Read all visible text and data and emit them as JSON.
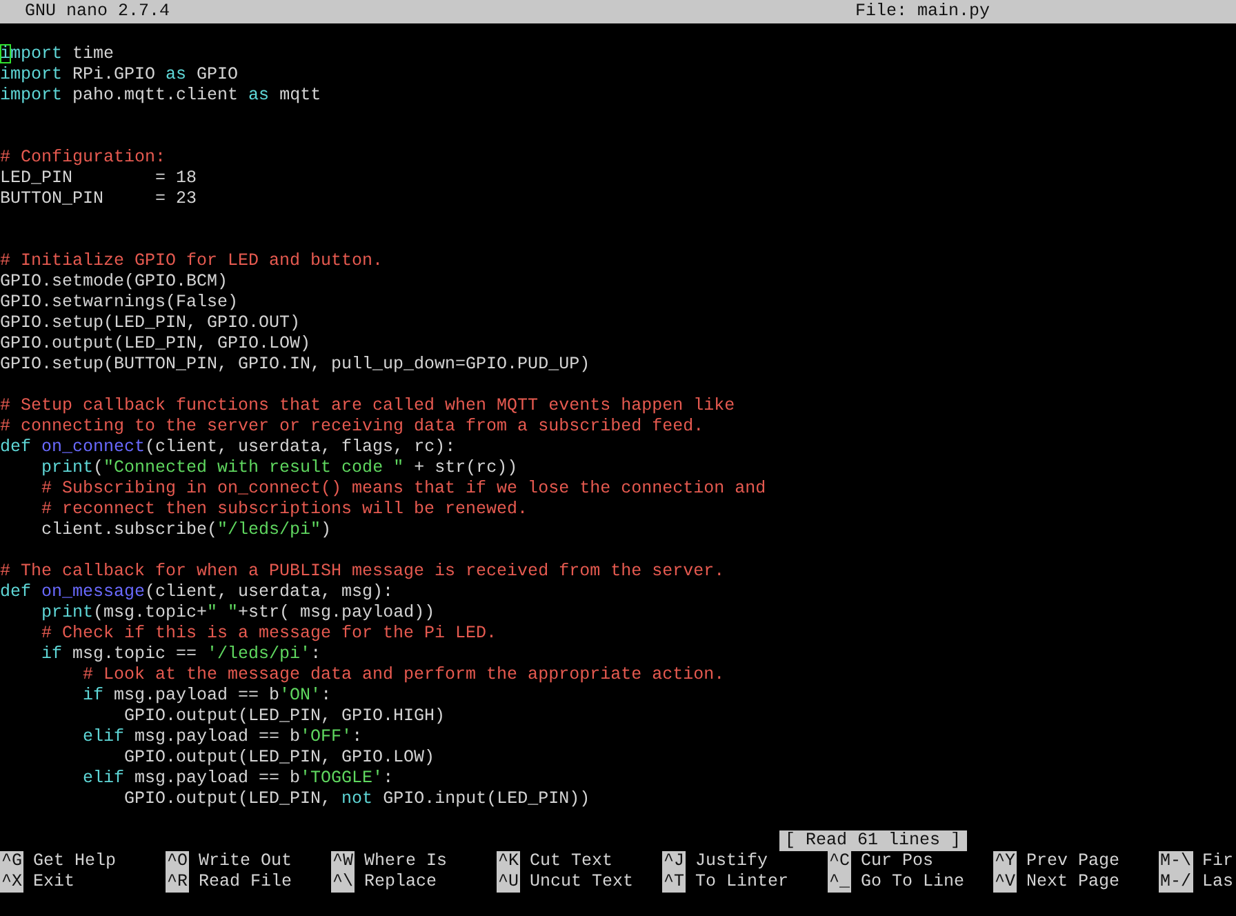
{
  "title_bar": {
    "app": "GNU nano 2.7.4",
    "file": "File: main.py"
  },
  "lines": [
    {
      "kind": "code",
      "segments": [
        {
          "text": "i",
          "kind": "keyword",
          "cursor": true
        },
        {
          "text": "mport",
          "kind": "keyword"
        },
        {
          "text": " time",
          "kind": "plain"
        }
      ]
    },
    {
      "kind": "code",
      "segments": [
        {
          "text": "import",
          "kind": "keyword"
        },
        {
          "text": " RPi.GPIO ",
          "kind": "plain"
        },
        {
          "text": "as",
          "kind": "keyword"
        },
        {
          "text": " GPIO",
          "kind": "plain"
        }
      ]
    },
    {
      "kind": "code",
      "segments": [
        {
          "text": "import",
          "kind": "keyword"
        },
        {
          "text": " paho.mqtt.client ",
          "kind": "plain"
        },
        {
          "text": "as",
          "kind": "keyword"
        },
        {
          "text": " mqtt",
          "kind": "plain"
        }
      ]
    },
    {
      "kind": "blank"
    },
    {
      "kind": "blank"
    },
    {
      "kind": "code",
      "segments": [
        {
          "text": "# Configuration:",
          "kind": "comment"
        }
      ]
    },
    {
      "kind": "code",
      "segments": [
        {
          "text": "LED_PIN        = 18",
          "kind": "plain"
        }
      ]
    },
    {
      "kind": "code",
      "segments": [
        {
          "text": "BUTTON_PIN     = 23",
          "kind": "plain"
        }
      ]
    },
    {
      "kind": "blank"
    },
    {
      "kind": "blank"
    },
    {
      "kind": "code",
      "segments": [
        {
          "text": "# Initialize GPIO for LED and button.",
          "kind": "comment"
        }
      ]
    },
    {
      "kind": "code",
      "segments": [
        {
          "text": "GPIO.setmode(GPIO.BCM)",
          "kind": "plain"
        }
      ]
    },
    {
      "kind": "code",
      "segments": [
        {
          "text": "GPIO.setwarnings(False)",
          "kind": "plain"
        }
      ]
    },
    {
      "kind": "code",
      "segments": [
        {
          "text": "GPIO.setup(LED_PIN, GPIO.OUT)",
          "kind": "plain"
        }
      ]
    },
    {
      "kind": "code",
      "segments": [
        {
          "text": "GPIO.output(LED_PIN, GPIO.LOW)",
          "kind": "plain"
        }
      ]
    },
    {
      "kind": "code",
      "segments": [
        {
          "text": "GPIO.setup(BUTTON_PIN, GPIO.IN, pull_up_down=GPIO.PUD_UP)",
          "kind": "plain"
        }
      ]
    },
    {
      "kind": "blank"
    },
    {
      "kind": "code",
      "segments": [
        {
          "text": "# Setup callback functions that are called when MQTT events happen like",
          "kind": "comment"
        }
      ]
    },
    {
      "kind": "code",
      "segments": [
        {
          "text": "# connecting to the server or receiving data from a subscribed feed.",
          "kind": "comment"
        }
      ]
    },
    {
      "kind": "code",
      "segments": [
        {
          "text": "def ",
          "kind": "keyword"
        },
        {
          "text": "on_connect",
          "kind": "function"
        },
        {
          "text": "(client, userdata, flags, rc):",
          "kind": "plain"
        }
      ]
    },
    {
      "kind": "code",
      "segments": [
        {
          "text": "    print",
          "kind": "keyword"
        },
        {
          "text": "(",
          "kind": "plain"
        },
        {
          "text": "\"Connected with result code \"",
          "kind": "string"
        },
        {
          "text": " + str(rc))",
          "kind": "plain"
        }
      ]
    },
    {
      "kind": "code",
      "segments": [
        {
          "text": "    # Subscribing in on_connect() means that if we lose the connection and",
          "kind": "comment"
        }
      ]
    },
    {
      "kind": "code",
      "segments": [
        {
          "text": "    # reconnect then subscriptions will be renewed.",
          "kind": "comment"
        }
      ]
    },
    {
      "kind": "code",
      "segments": [
        {
          "text": "    client.subscribe(",
          "kind": "plain"
        },
        {
          "text": "\"/leds/pi\"",
          "kind": "string"
        },
        {
          "text": ")",
          "kind": "plain"
        }
      ]
    },
    {
      "kind": "blank"
    },
    {
      "kind": "code",
      "segments": [
        {
          "text": "# The callback for when a PUBLISH message is received from the server.",
          "kind": "comment"
        }
      ]
    },
    {
      "kind": "code",
      "segments": [
        {
          "text": "def ",
          "kind": "keyword"
        },
        {
          "text": "on_message",
          "kind": "function"
        },
        {
          "text": "(client, userdata, msg):",
          "kind": "plain"
        }
      ]
    },
    {
      "kind": "code",
      "segments": [
        {
          "text": "    print",
          "kind": "keyword"
        },
        {
          "text": "(msg.topic+",
          "kind": "plain"
        },
        {
          "text": "\" \"",
          "kind": "string"
        },
        {
          "text": "+str( msg.payload))",
          "kind": "plain"
        }
      ]
    },
    {
      "kind": "code",
      "segments": [
        {
          "text": "    # Check if this is a message for the Pi LED.",
          "kind": "comment"
        }
      ]
    },
    {
      "kind": "code",
      "segments": [
        {
          "text": "    if",
          "kind": "keyword"
        },
        {
          "text": " msg.topic == ",
          "kind": "plain"
        },
        {
          "text": "'/leds/pi'",
          "kind": "string"
        },
        {
          "text": ":",
          "kind": "plain"
        }
      ]
    },
    {
      "kind": "code",
      "segments": [
        {
          "text": "        # Look at the message data and perform the appropriate action.",
          "kind": "comment"
        }
      ]
    },
    {
      "kind": "code",
      "segments": [
        {
          "text": "        if",
          "kind": "keyword"
        },
        {
          "text": " msg.payload == b",
          "kind": "plain"
        },
        {
          "text": "'ON'",
          "kind": "string"
        },
        {
          "text": ":",
          "kind": "plain"
        }
      ]
    },
    {
      "kind": "code",
      "segments": [
        {
          "text": "            GPIO.output(LED_PIN, GPIO.HIGH)",
          "kind": "plain"
        }
      ]
    },
    {
      "kind": "code",
      "segments": [
        {
          "text": "        elif",
          "kind": "keyword"
        },
        {
          "text": " msg.payload == b",
          "kind": "plain"
        },
        {
          "text": "'OFF'",
          "kind": "string"
        },
        {
          "text": ":",
          "kind": "plain"
        }
      ]
    },
    {
      "kind": "code",
      "segments": [
        {
          "text": "            GPIO.output(LED_PIN, GPIO.LOW)",
          "kind": "plain"
        }
      ]
    },
    {
      "kind": "code",
      "segments": [
        {
          "text": "        elif",
          "kind": "keyword"
        },
        {
          "text": " msg.payload == b",
          "kind": "plain"
        },
        {
          "text": "'TOGGLE'",
          "kind": "string"
        },
        {
          "text": ":",
          "kind": "plain"
        }
      ]
    },
    {
      "kind": "code",
      "segments": [
        {
          "text": "            GPIO.output(LED_PIN, ",
          "kind": "plain"
        },
        {
          "text": "not",
          "kind": "keyword"
        },
        {
          "text": " GPIO.input(LED_PIN))",
          "kind": "plain"
        }
      ]
    }
  ],
  "status_message": "[ Read 61 lines ]",
  "shortcut_rows": [
    [
      {
        "key": "^G",
        "label": "Get Help"
      },
      {
        "key": "^O",
        "label": "Write Out"
      },
      {
        "key": "^W",
        "label": "Where Is"
      },
      {
        "key": "^K",
        "label": "Cut Text"
      },
      {
        "key": "^J",
        "label": "Justify"
      },
      {
        "key": "^C",
        "label": "Cur Pos"
      },
      {
        "key": "^Y",
        "label": "Prev Page"
      },
      {
        "key": "M-\\",
        "label": "Fir"
      }
    ],
    [
      {
        "key": "^X",
        "label": "Exit"
      },
      {
        "key": "^R",
        "label": "Read File"
      },
      {
        "key": "^\\",
        "label": "Replace"
      },
      {
        "key": "^U",
        "label": "Uncut Text"
      },
      {
        "key": "^T",
        "label": "To Linter"
      },
      {
        "key": "^_",
        "label": "Go To Line"
      },
      {
        "key": "^V",
        "label": "Next Page"
      },
      {
        "key": "M-/",
        "label": "Las"
      }
    ]
  ]
}
